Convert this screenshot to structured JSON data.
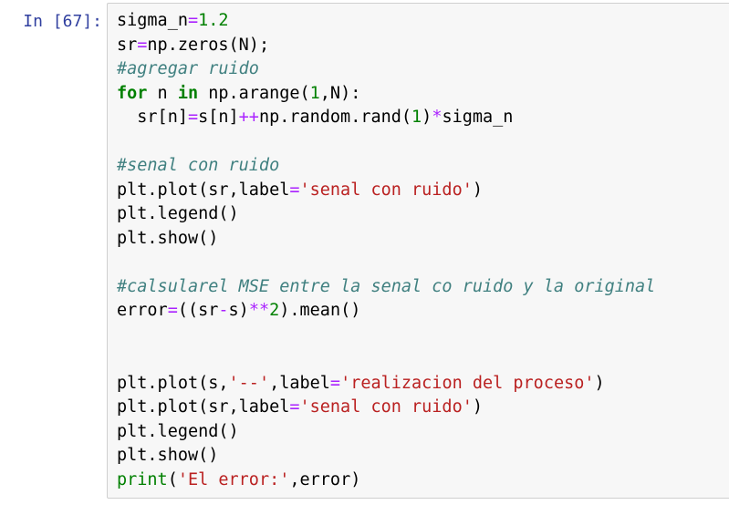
{
  "prompt": "In [67]:",
  "code_lines": [
    [
      [
        "plain",
        "sigma_n"
      ],
      [
        "op",
        "="
      ],
      [
        "num",
        "1.2"
      ]
    ],
    [
      [
        "plain",
        "sr"
      ],
      [
        "op",
        "="
      ],
      [
        "plain",
        "np.zeros(N);"
      ]
    ],
    [
      [
        "com",
        "#agregar ruido"
      ]
    ],
    [
      [
        "kw",
        "for"
      ],
      [
        "plain",
        " n "
      ],
      [
        "kw",
        "in"
      ],
      [
        "plain",
        " np.arange("
      ],
      [
        "num",
        "1"
      ],
      [
        "plain",
        ",N):"
      ]
    ],
    [
      [
        "plain",
        "  sr[n]"
      ],
      [
        "op",
        "="
      ],
      [
        "plain",
        "s[n]"
      ],
      [
        "op",
        "++"
      ],
      [
        "plain",
        "np.random.rand("
      ],
      [
        "num",
        "1"
      ],
      [
        "plain",
        ")"
      ],
      [
        "op",
        "*"
      ],
      [
        "plain",
        "sigma_n"
      ]
    ],
    [],
    [
      [
        "com",
        "#senal con ruido"
      ]
    ],
    [
      [
        "plain",
        "plt.plot(sr,label"
      ],
      [
        "op",
        "="
      ],
      [
        "str",
        "'senal con ruido'"
      ],
      [
        "plain",
        ")"
      ]
    ],
    [
      [
        "plain",
        "plt.legend()"
      ]
    ],
    [
      [
        "plain",
        "plt.show()"
      ]
    ],
    [],
    [
      [
        "com",
        "#calsularel MSE entre la senal co ruido y la original"
      ]
    ],
    [
      [
        "plain",
        "error"
      ],
      [
        "op",
        "="
      ],
      [
        "plain",
        "((sr"
      ],
      [
        "op",
        "-"
      ],
      [
        "plain",
        "s)"
      ],
      [
        "op",
        "**"
      ],
      [
        "num",
        "2"
      ],
      [
        "plain",
        ").mean()"
      ]
    ],
    [],
    [],
    [
      [
        "plain",
        "plt.plot(s,"
      ],
      [
        "str",
        "'--'"
      ],
      [
        "plain",
        ",label"
      ],
      [
        "op",
        "="
      ],
      [
        "str",
        "'realizacion del proceso'"
      ],
      [
        "plain",
        ")"
      ]
    ],
    [
      [
        "plain",
        "plt.plot(sr,label"
      ],
      [
        "op",
        "="
      ],
      [
        "str",
        "'senal con ruido'"
      ],
      [
        "plain",
        ")"
      ]
    ],
    [
      [
        "plain",
        "plt.legend()"
      ]
    ],
    [
      [
        "plain",
        "plt.show()"
      ]
    ],
    [
      [
        "builtin",
        "print"
      ],
      [
        "plain",
        "("
      ],
      [
        "str",
        "'El error:'"
      ],
      [
        "plain",
        ",error)"
      ]
    ]
  ]
}
